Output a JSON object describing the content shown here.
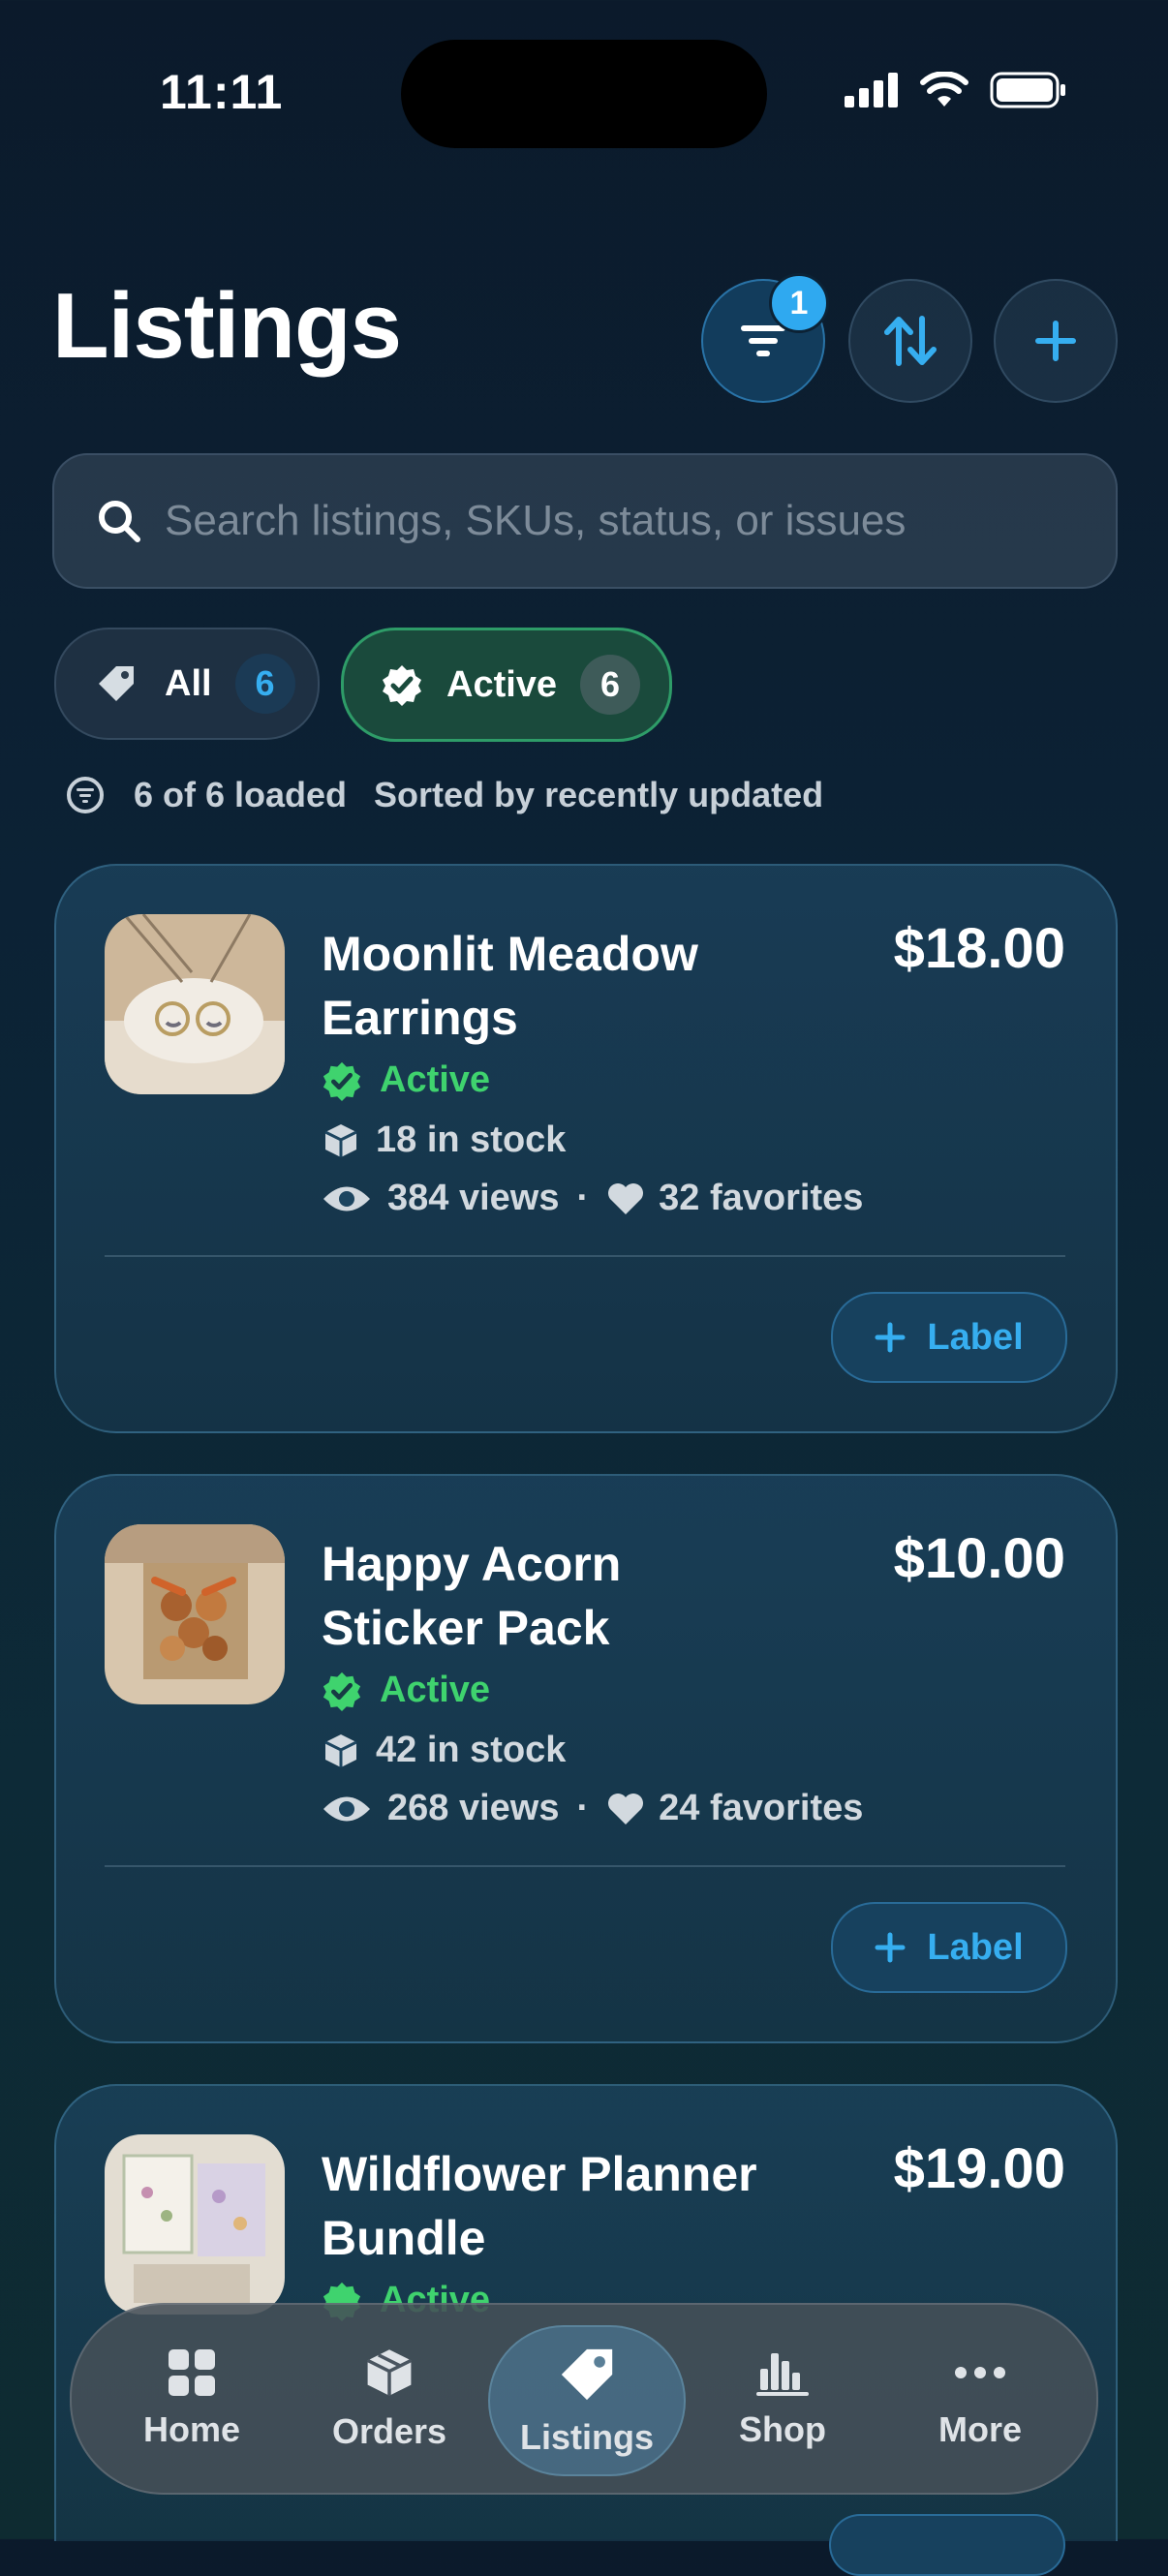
{
  "status_bar": {
    "time": "11:11"
  },
  "header": {
    "title": "Listings",
    "filter_badge": "1"
  },
  "search": {
    "placeholder": "Search listings, SKUs, status, or issues"
  },
  "chips": [
    {
      "label": "All",
      "count": "6"
    },
    {
      "label": "Active",
      "count": "6"
    }
  ],
  "summary": {
    "loaded": "6 of 6 loaded",
    "sort": "Sorted by recently updated"
  },
  "listings": [
    {
      "title": "Moonlit Meadow Earrings",
      "price": "$18.00",
      "status": "Active",
      "stock": "18 in stock",
      "views": "384 views",
      "favorites": "32 favorites",
      "label_button": "Label"
    },
    {
      "title": "Happy Acorn Sticker Pack",
      "price": "$10.00",
      "status": "Active",
      "stock": "42 in stock",
      "views": "268 views",
      "favorites": "24 favorites",
      "label_button": "Label"
    },
    {
      "title": "Wildflower Planner Bundle",
      "price": "$19.00",
      "status": "Active"
    }
  ],
  "tabbar": [
    {
      "label": "Home",
      "icon": "grid-icon"
    },
    {
      "label": "Orders",
      "icon": "box-icon"
    },
    {
      "label": "Listings",
      "icon": "tag-icon"
    },
    {
      "label": "Shop",
      "icon": "bar-chart-icon"
    },
    {
      "label": "More",
      "icon": "ellipsis-icon"
    }
  ],
  "colors": {
    "accent": "#36aef0",
    "active_green": "#3fd36e",
    "background": "#0c2235"
  }
}
